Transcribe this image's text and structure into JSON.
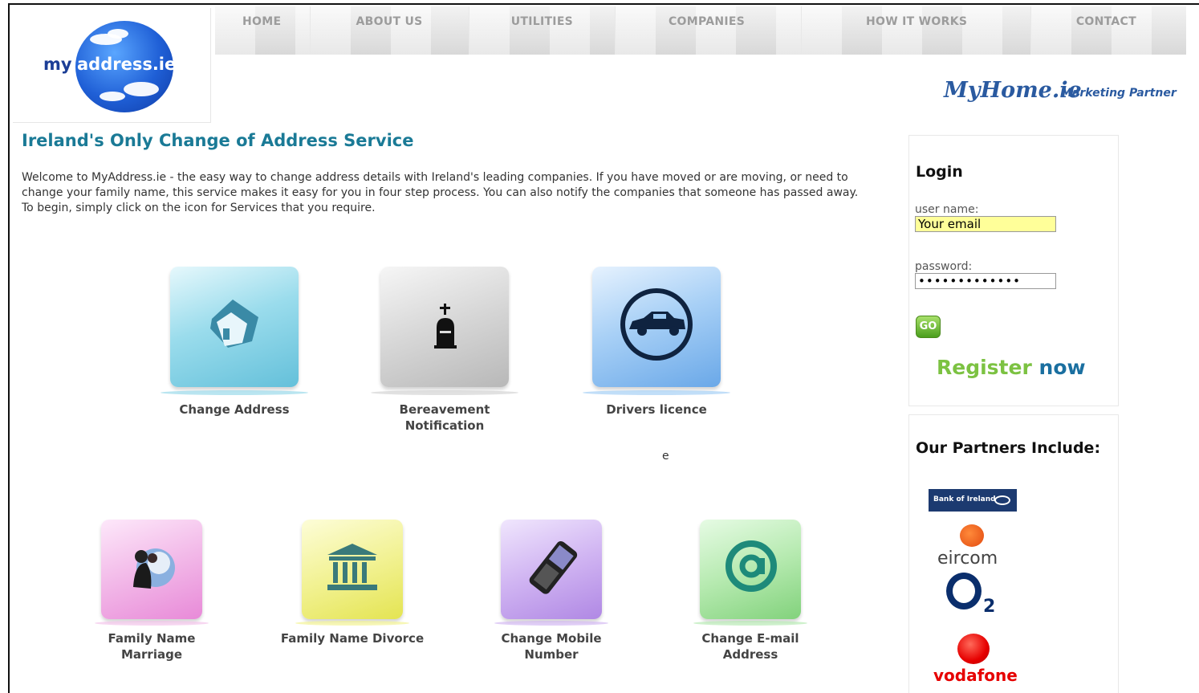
{
  "logo": {
    "my": "my",
    "rest": "address.ie"
  },
  "nav": [
    {
      "label": "HOME"
    },
    {
      "label": "ABOUT US"
    },
    {
      "label": "UTILITIES"
    },
    {
      "label": "COMPANIES"
    },
    {
      "label": "HOW IT WORKS"
    },
    {
      "label": "CONTACT"
    }
  ],
  "partner": {
    "brand": "MyHome.ie",
    "tag": "Marketing Partner"
  },
  "main": {
    "title": "Ireland's Only Change of Address Service",
    "intro": "Welcome to MyAddress.ie - the easy way to change address details with Ireland's leading companies. If you have moved or are moving, or need to change your family name, this service makes it easy for you in four step process. You can also notify the companies that someone has passed away. To begin, simply click on the icon for Services that you require.",
    "stray_char": "e"
  },
  "services": [
    {
      "label": "Change Address",
      "icon": "house-icon",
      "color": "#7fd0e4"
    },
    {
      "label": "Bereavement Notification",
      "icon": "tombstone-icon",
      "color": "#c8c8c8"
    },
    {
      "label": "Drivers licence",
      "icon": "car-icon",
      "color": "#8ec3f2"
    },
    {
      "label": "Family Name Marriage",
      "icon": "couple-icon",
      "color": "#f0b6e6"
    },
    {
      "label": "Family Name Divorce",
      "icon": "courthouse-icon",
      "color": "#f0f07a"
    },
    {
      "label": "Change Mobile Number",
      "icon": "mobile-phone-icon",
      "color": "#c9a8ee"
    },
    {
      "label": "Change E-mail Address",
      "icon": "at-sign-icon",
      "color": "#a6e6a2"
    }
  ],
  "login": {
    "title": "Login",
    "username_label": "user name:",
    "username_value": "Your email",
    "password_label": "password:",
    "password_value": "•••••••••••••",
    "go_label": "GO",
    "register_word1": "Register",
    "register_word2": "now"
  },
  "partners": {
    "title": "Our Partners Include:",
    "logos": [
      {
        "name": "Bank of Ireland",
        "icon": "bank-of-ireland-logo"
      },
      {
        "name": "eircom",
        "icon": "eircom-logo"
      },
      {
        "name": "O2",
        "icon": "o2-logo"
      },
      {
        "name": "vodafone",
        "icon": "vodafone-logo"
      }
    ]
  },
  "colors": {
    "title": "#1a7a96",
    "register_green": "#7cc242",
    "register_blue": "#1a6fa0",
    "highlight": "#ffff99"
  }
}
